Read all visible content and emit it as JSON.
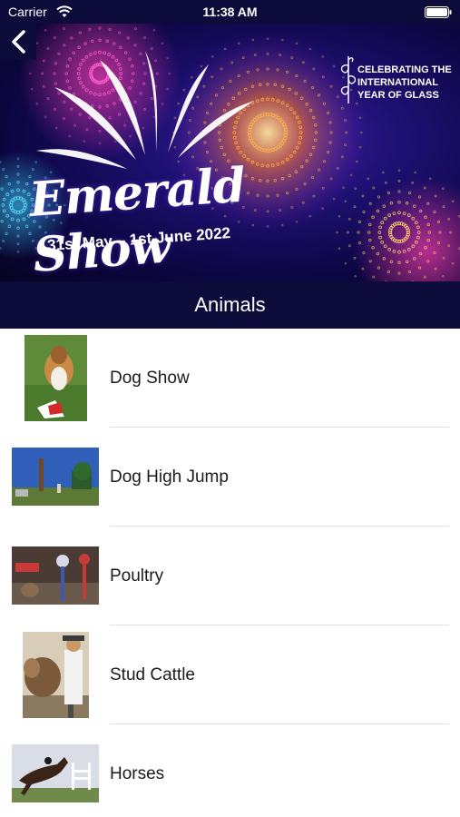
{
  "status_bar": {
    "carrier": "Carrier",
    "time": "11:38 AM"
  },
  "banner": {
    "title": "Emerald Show",
    "dates": "31st May – 1st June 2022",
    "badge_text": "CELEBRATING THE\nINTERNATIONAL\nYEAR OF GLASS"
  },
  "header": {
    "title": "Animals"
  },
  "items": [
    {
      "label": "Dog Show"
    },
    {
      "label": "Dog High Jump"
    },
    {
      "label": "Poultry"
    },
    {
      "label": "Stud Cattle"
    },
    {
      "label": "Horses"
    }
  ],
  "colors": {
    "nav_background": "#0c0b3a",
    "divider": "#e2e2e2",
    "text": "#1a1a1a"
  }
}
